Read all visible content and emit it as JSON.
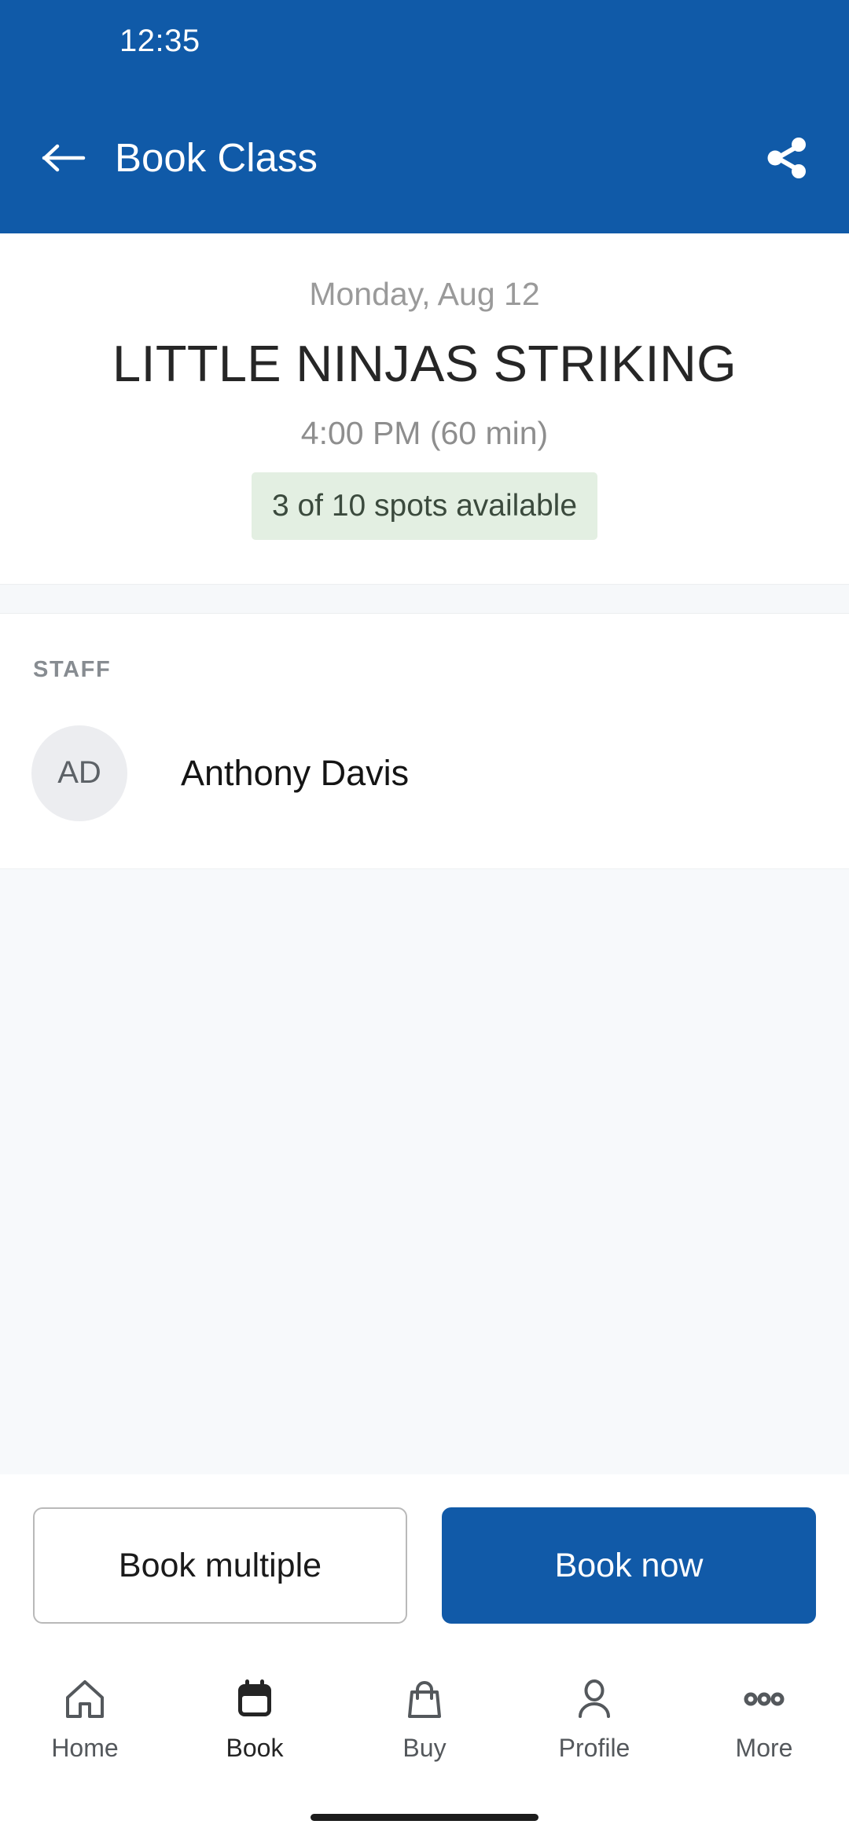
{
  "status_bar": {
    "time": "12:35"
  },
  "app_bar": {
    "title": "Book Class",
    "back_icon": "arrow-left-icon",
    "share_icon": "share-icon",
    "background_color": "#105aa8"
  },
  "class_details": {
    "date": "Monday, Aug 12",
    "name": "LITTLE NINJAS STRIKING",
    "time": "4:00 PM (60 min)",
    "availability": "3 of 10 spots available",
    "availability_bg_color": "#e3efe2"
  },
  "staff": {
    "heading": "STAFF",
    "members": [
      {
        "initials": "AD",
        "name": "Anthony Davis"
      }
    ]
  },
  "actions": {
    "secondary_label": "Book multiple",
    "primary_label": "Book now",
    "primary_color": "#115aa8"
  },
  "bottom_nav": {
    "items": [
      {
        "label": "Home",
        "icon": "home-icon",
        "active": false
      },
      {
        "label": "Book",
        "icon": "calendar-icon",
        "active": true
      },
      {
        "label": "Buy",
        "icon": "shopping-bag-icon",
        "active": false
      },
      {
        "label": "Profile",
        "icon": "person-icon",
        "active": false
      },
      {
        "label": "More",
        "icon": "ellipsis-icon",
        "active": false
      }
    ]
  }
}
